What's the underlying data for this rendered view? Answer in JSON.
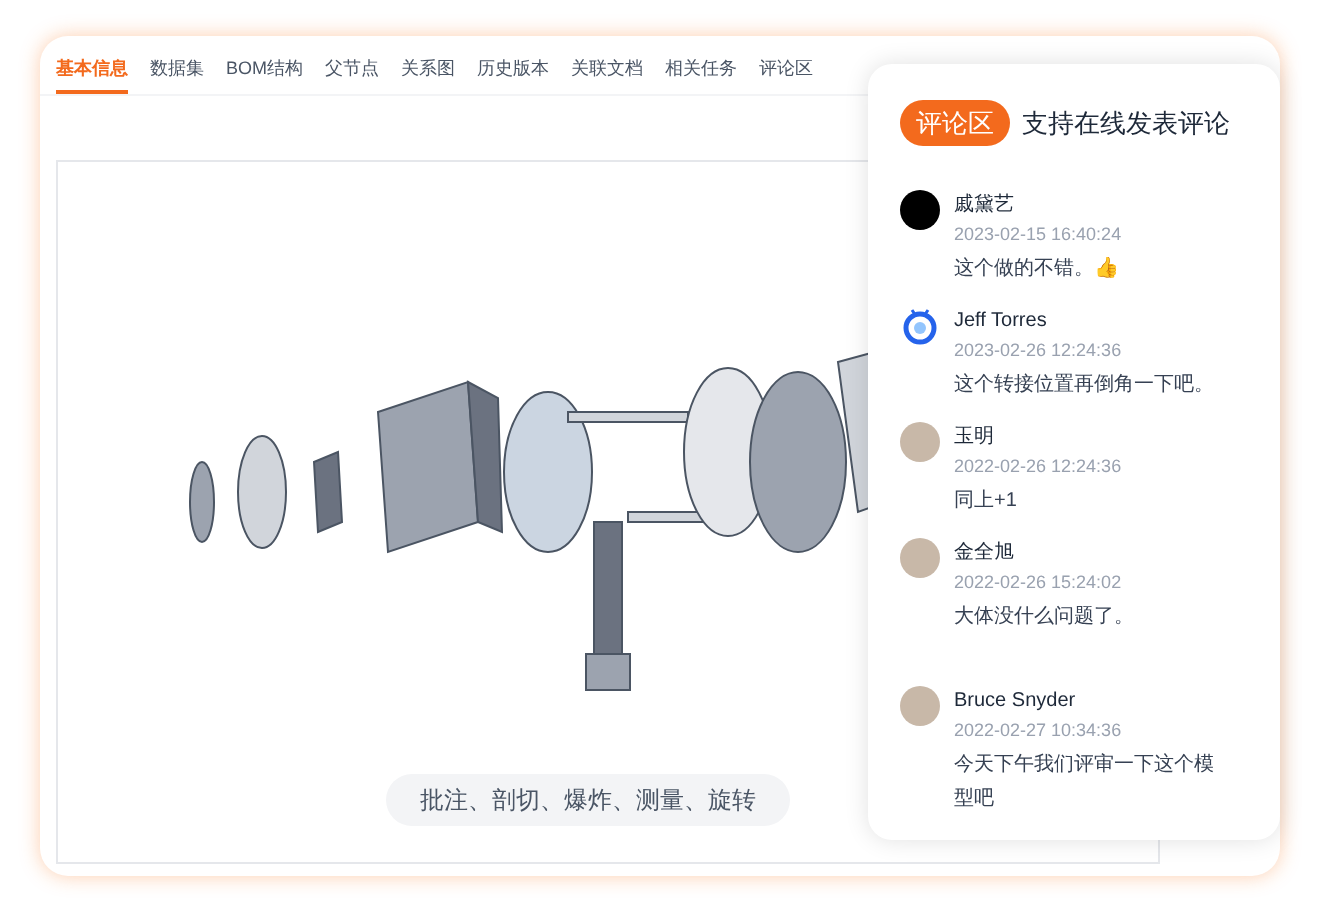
{
  "tabs": [
    {
      "label": "基本信息",
      "selected": true
    },
    {
      "label": "数据集",
      "selected": false
    },
    {
      "label": "BOM结构",
      "selected": false
    },
    {
      "label": "父节点",
      "selected": false
    },
    {
      "label": "关系图",
      "selected": false
    },
    {
      "label": "历史版本",
      "selected": false
    },
    {
      "label": "关联文档",
      "selected": false
    },
    {
      "label": "相关任务",
      "selected": false
    },
    {
      "label": "评论区",
      "selected": false
    }
  ],
  "viewer": {
    "toolbar_hint": "批注、剖切、爆炸、测量、旋转"
  },
  "comments_panel": {
    "badge": "评论区",
    "subtitle": "支持在线发表评论",
    "comments": [
      {
        "kind": "logo",
        "author": "戚黛艺",
        "time": "2023-02-15 16:40:24",
        "text": "这个做的不错。👍"
      },
      {
        "kind": "robot",
        "author": "Jeff Torres",
        "time": "2023-02-26 12:24:36",
        "text": "这个转接位置再倒角一下吧。"
      },
      {
        "kind": "photo",
        "author": "玉明",
        "time": "2022-02-26 12:24:36",
        "text": "同上+1"
      },
      {
        "kind": "photo",
        "author": "金全旭",
        "time": "2022-02-26 15:24:02",
        "text": "大体没什么问题了。"
      },
      {
        "kind": "photo",
        "author": "Bruce Snyder",
        "time": "2022-02-27 10:34:36",
        "text": "今天下午我们评审一下这个模型吧"
      }
    ]
  }
}
